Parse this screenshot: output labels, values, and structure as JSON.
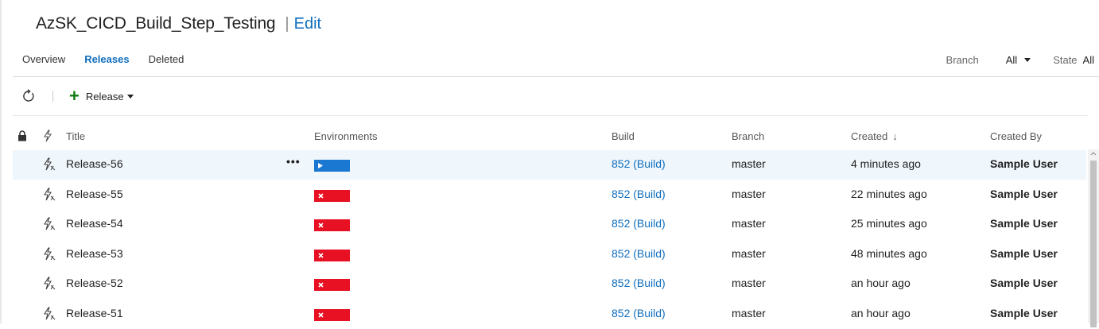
{
  "header": {
    "definition_title": "AzSK_CICD_Build_Step_Testing",
    "separator": "|",
    "edit_label": "Edit"
  },
  "tabs": [
    {
      "label": "Overview",
      "active": false
    },
    {
      "label": "Releases",
      "active": true
    },
    {
      "label": "Deleted",
      "active": false
    }
  ],
  "filters": {
    "branch_label": "Branch",
    "branch_value": "All",
    "state_label": "State",
    "state_value": "All"
  },
  "toolbar": {
    "refresh_icon": "refresh-icon",
    "new_release_label": "Release"
  },
  "columns": {
    "lock_icon": "lock-icon",
    "trigger_icon": "lightning-icon",
    "title": "Title",
    "environments": "Environments",
    "build": "Build",
    "branch": "Branch",
    "created": "Created",
    "created_by": "Created By"
  },
  "colors": {
    "accent": "#106ebe",
    "env_running": "#1a78d2",
    "env_failed": "#e81123",
    "selected_row": "#eff6fc"
  },
  "rows": [
    {
      "title": "Release-56",
      "more": "•••",
      "env_status": "running",
      "build": "852 (Build)",
      "branch": "master",
      "created": "4 minutes ago",
      "created_by": "Sample User"
    },
    {
      "title": "Release-55",
      "more": "",
      "env_status": "failed",
      "build": "852 (Build)",
      "branch": "master",
      "created": "22 minutes ago",
      "created_by": "Sample User"
    },
    {
      "title": "Release-54",
      "more": "",
      "env_status": "failed",
      "build": "852 (Build)",
      "branch": "master",
      "created": "25 minutes ago",
      "created_by": "Sample User"
    },
    {
      "title": "Release-53",
      "more": "",
      "env_status": "failed",
      "build": "852 (Build)",
      "branch": "master",
      "created": "48 minutes ago",
      "created_by": "Sample User"
    },
    {
      "title": "Release-52",
      "more": "",
      "env_status": "failed",
      "build": "852 (Build)",
      "branch": "master",
      "created": "an hour ago",
      "created_by": "Sample User"
    },
    {
      "title": "Release-51",
      "more": "",
      "env_status": "failed",
      "build": "852 (Build)",
      "branch": "master",
      "created": "an hour ago",
      "created_by": "Sample User"
    }
  ]
}
